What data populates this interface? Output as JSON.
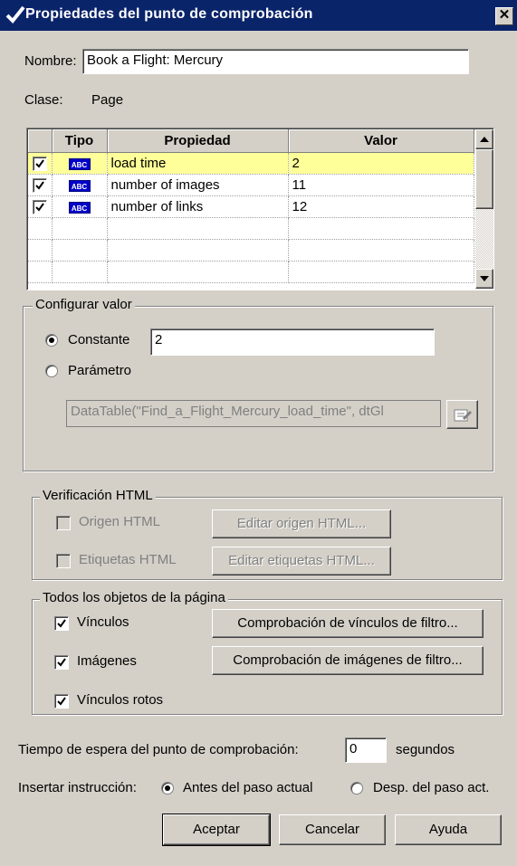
{
  "window": {
    "title": "Propiedades del punto de comprobación",
    "close_label": "✕"
  },
  "nombre": {
    "label": "Nombre:",
    "value": "Book a Flight: Mercury"
  },
  "clase": {
    "label": "Clase:",
    "value": "Page"
  },
  "grid": {
    "headers": [
      "Tipo",
      "Propiedad",
      "Valor"
    ],
    "rows": [
      {
        "checked": true,
        "type_icon": "abc-icon",
        "icon_text": "ABC",
        "property": "load time",
        "value": "2",
        "selected": true
      },
      {
        "checked": true,
        "type_icon": "abc-icon",
        "icon_text": "ABC",
        "property": "number of images",
        "value": "11",
        "selected": false
      },
      {
        "checked": true,
        "type_icon": "abc-icon",
        "icon_text": "ABC",
        "property": "number of links",
        "value": "12",
        "selected": false
      }
    ]
  },
  "configurar": {
    "legend": "Configurar valor",
    "constante_label": "Constante",
    "constante_value": "2",
    "parametro_label": "Parámetro",
    "parametro_value": "DataTable(\"Find_a_Flight_Mercury_load_time\", dtGl",
    "parametro_icon": "edit-parameter-icon"
  },
  "verificacion": {
    "legend": "Verificación HTML",
    "origen_label": "Origen HTML",
    "origen_button": "Editar origen HTML...",
    "etiquetas_label": "Etiquetas HTML",
    "etiquetas_button": "Editar etiquetas HTML..."
  },
  "todos": {
    "legend": "Todos los objetos de la página",
    "vinculos_label": "Vínculos",
    "vinculos_button": "Comprobación de vínculos de filtro...",
    "imagenes_label": "Imágenes",
    "imagenes_button": "Comprobación de imágenes de filtro...",
    "rotos_label": "Vínculos rotos"
  },
  "tiempo": {
    "label": "Tiempo de espera del punto de comprobación:",
    "value": "0",
    "unit": "segundos"
  },
  "insertar": {
    "label": "Insertar instrucción:",
    "option1": "Antes del paso actual",
    "option2": "Desp. del paso act."
  },
  "buttons": {
    "accept": "Aceptar",
    "cancel": "Cancelar",
    "help": "Ayuda"
  },
  "colors": {
    "title_bar": "#0a246a",
    "selected_row": "#ffff99",
    "dialog_bg": "#d4d0c8"
  }
}
